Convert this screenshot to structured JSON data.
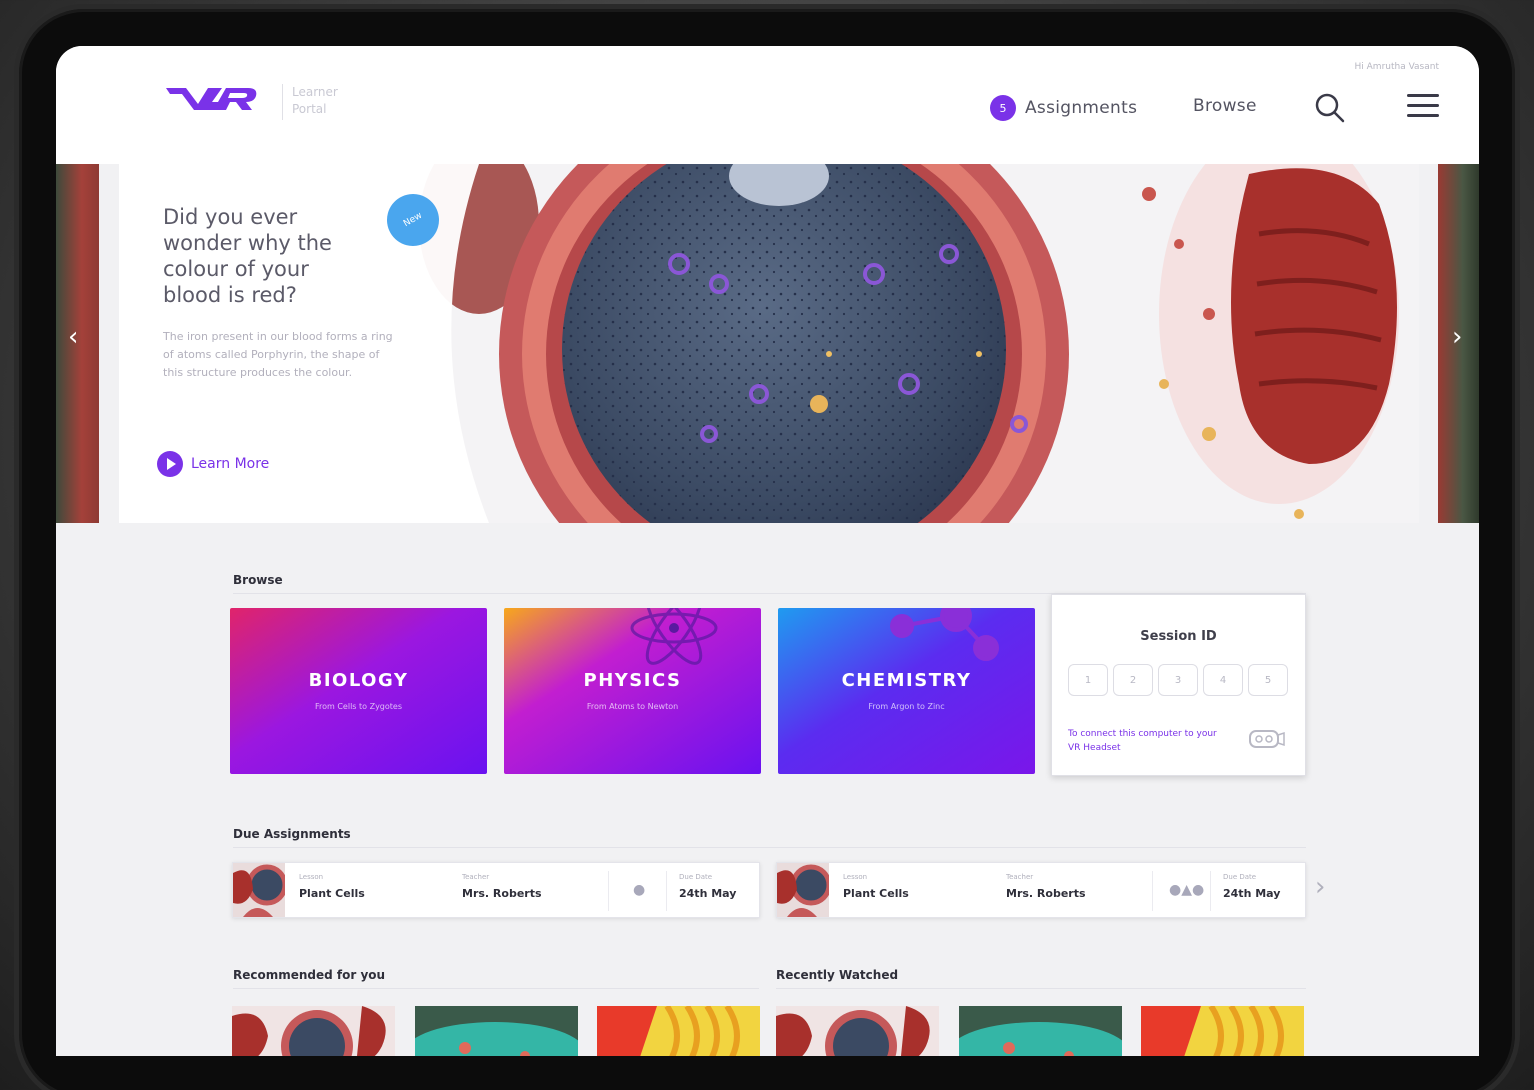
{
  "header": {
    "logo_text": "VR",
    "portal_label": "Learner Portal",
    "greeting": "Hi Amrutha Vasant",
    "assignments_count": "5",
    "assignments_label": "Assignments",
    "browse_label": "Browse"
  },
  "hero": {
    "badge": "New",
    "title": "Did you ever wonder why the colour of your blood is red?",
    "description": "The iron present in our blood forms a ring of atoms called Porphyrin, the shape of this structure produces the colour.",
    "cta": "Learn More",
    "prev_arrow": "‹",
    "next_arrow": "›"
  },
  "browse": {
    "title": "Browse",
    "categories": [
      {
        "title": "BIOLOGY",
        "subtitle": "From Cells to Zygotes"
      },
      {
        "title": "PHYSICS",
        "subtitle": "From Atoms to Newton"
      },
      {
        "title": "CHEMISTRY",
        "subtitle": "From Argon to Zinc"
      }
    ],
    "session": {
      "title": "Session ID",
      "digits": [
        "1",
        "2",
        "3",
        "4",
        "5"
      ],
      "help": "To connect this computer to your VR Headset"
    }
  },
  "due_assignments": {
    "title": "Due Assignments",
    "items": [
      {
        "lesson_label": "Lesson",
        "lesson": "Plant Cells",
        "teacher_label": "Teacher",
        "teacher": "Mrs. Roberts",
        "due_label": "Due Date",
        "due": "24th May"
      },
      {
        "lesson_label": "Lesson",
        "lesson": "Plant Cells",
        "teacher_label": "Teacher",
        "teacher": "Mrs. Roberts",
        "due_label": "Due Date",
        "due": "24th May"
      }
    ],
    "next_arrow": "›"
  },
  "recommended": {
    "title": "Recommended for you"
  },
  "recently_watched": {
    "title": "Recently Watched"
  },
  "colors": {
    "accent": "#7a32e8",
    "badge_blue": "#4aa6ee"
  }
}
